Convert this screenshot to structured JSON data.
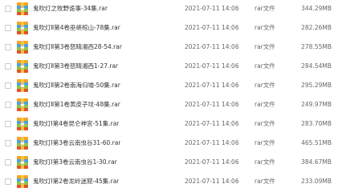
{
  "files": [
    {
      "name": "鬼吹灯之牧野诡事-34集.rar",
      "date": "2021-07-11 14:06",
      "type": "rar文件",
      "size": "344.29MB"
    },
    {
      "name": "鬼吹灯Ⅱ第4卷巫峡棺山-78集.rar",
      "date": "2021-07-11 14:06",
      "type": "rar文件",
      "size": "282.26MB"
    },
    {
      "name": "鬼吹灯Ⅱ第3卷怒晴湘西28-54.rar",
      "date": "2021-07-11 14:06",
      "type": "rar文件",
      "size": "278.55MB"
    },
    {
      "name": "鬼吹灯Ⅱ第3卷怒晴湘西1-27.rar",
      "date": "2021-07-11 14:06",
      "type": "rar文件",
      "size": "284.54MB"
    },
    {
      "name": "鬼吹灯Ⅱ第2卷南海归墟-50集.rar",
      "date": "2021-07-11 14:06",
      "type": "rar文件",
      "size": "295.29MB"
    },
    {
      "name": "鬼吹灯Ⅱ第1卷黄皮子坟-48集.rar",
      "date": "2021-07-11 14:06",
      "type": "rar文件",
      "size": "249.97MB"
    },
    {
      "name": "鬼吹灯Ⅰ第4卷昆仑神宫-51集.rar",
      "date": "2021-07-11 14:06",
      "type": "rar文件",
      "size": "283.70MB"
    },
    {
      "name": "鬼吹灯Ⅰ第3卷云南虫谷31-60.rar",
      "date": "2021-07-11 14:06",
      "type": "rar文件",
      "size": "465.51MB"
    },
    {
      "name": "鬼吹灯Ⅰ第3卷云南虫谷1-30.rar",
      "date": "2021-07-11 14:06",
      "type": "rar文件",
      "size": "384.67MB"
    },
    {
      "name": "鬼吹灯Ⅰ第2卷龙岭迷窟-45集.rar",
      "date": "2021-07-11 14:06",
      "type": "rar文件",
      "size": "233.09MB"
    }
  ],
  "icon": "rar-archive-icon",
  "colors": {
    "archive_stripe_1": "#e0522f",
    "archive_stripe_2": "#f5a623",
    "archive_stripe_3": "#4aa3df",
    "archive_stripe_4": "#8dc63f",
    "archive_band": "#f7c948"
  }
}
